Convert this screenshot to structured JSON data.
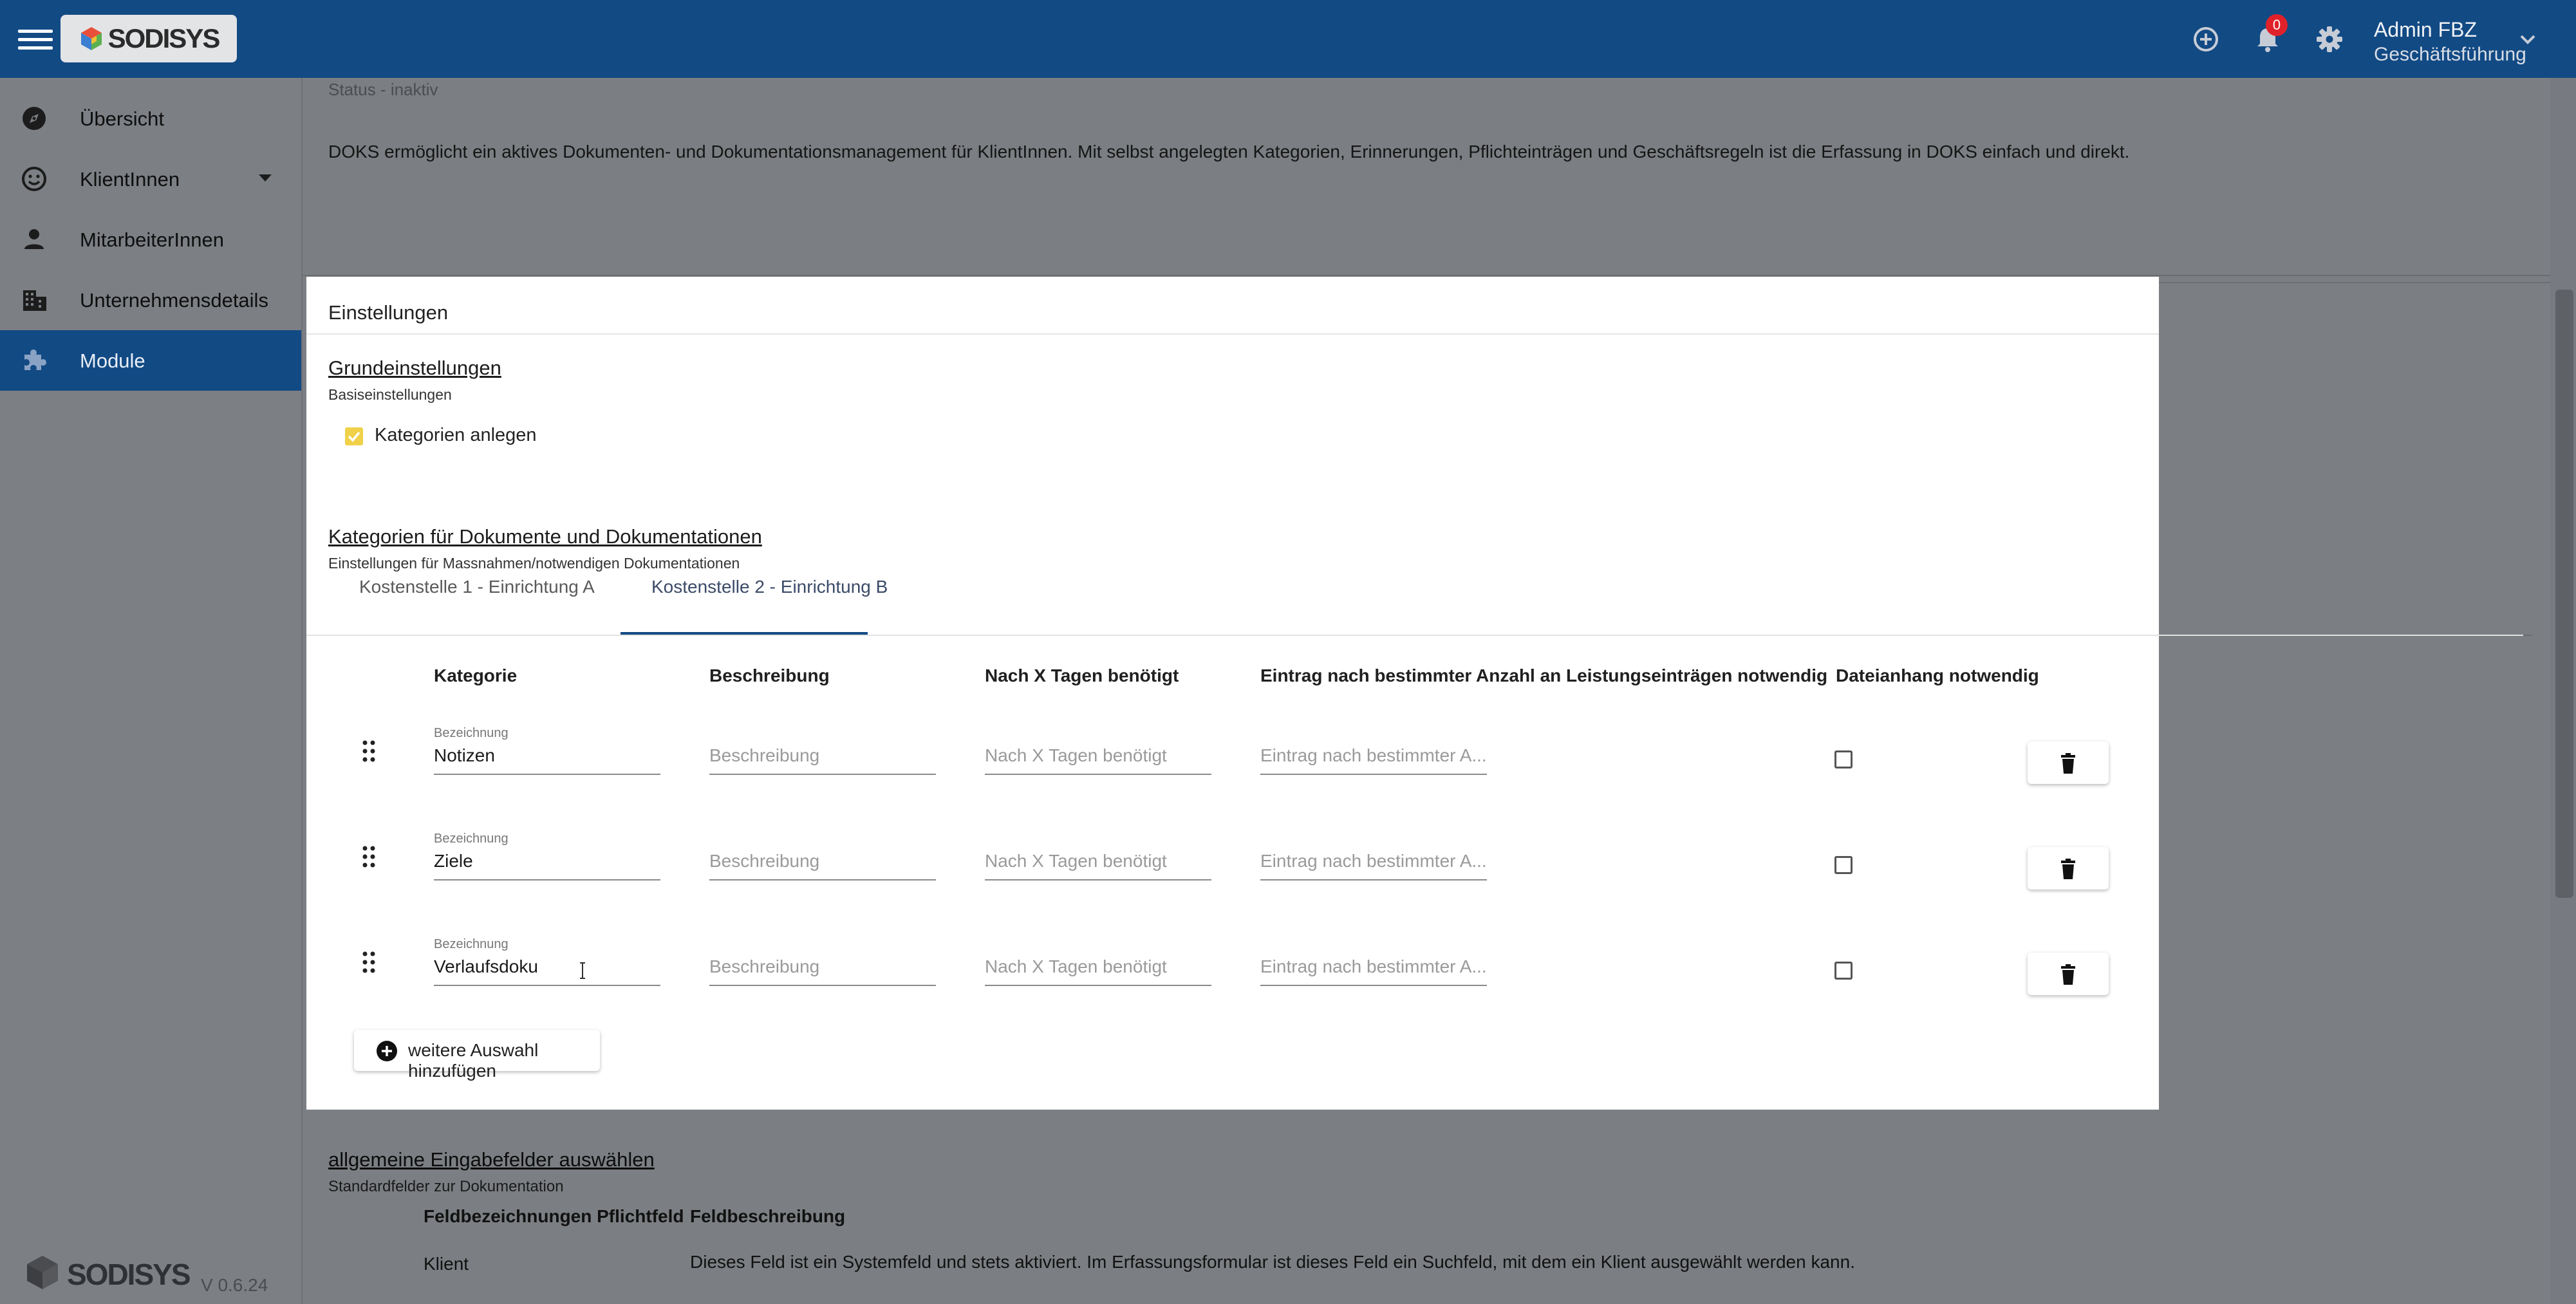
{
  "app": {
    "logo_text": "SODISYS",
    "notifications_count": "0",
    "user_name": "Admin FBZ",
    "user_role": "Geschäftsführung",
    "version": "V 0.6.24",
    "brand_color": "#124a84"
  },
  "sidebar": {
    "items": [
      {
        "label": "Übersicht",
        "icon": "compass-icon"
      },
      {
        "label": "KlientInnen",
        "icon": "smiley-icon"
      },
      {
        "label": "MitarbeiterInnen",
        "icon": "person-icon"
      },
      {
        "label": "Unternehmensdetails",
        "icon": "building-icon"
      },
      {
        "label": "Module",
        "icon": "puzzle-icon",
        "active": true
      }
    ]
  },
  "background": {
    "status": "Status - inaktiv",
    "description": "DOKS ermöglicht ein aktives Dokumenten- und Dokumentationsmanagement für KlientInnen. Mit selbst angelegten Kategorien, Erinnerungen, Pflichteinträgen und Geschäftsregeln ist die Erfassung in DOKS einfach und direkt.",
    "general_fields": {
      "title": "allgemeine Eingabefelder auswählen",
      "subtitle": "Standardfelder zur Dokumentation",
      "headers": [
        "Feldbezeichnungen Pflichtfeld",
        "Feldbeschreibung"
      ],
      "rows": [
        {
          "name": "Klient",
          "desc": "Dieses Feld ist ein Systemfeld und stets aktiviert. Im Erfassungsformular ist dieses Feld ein Suchfeld, mit dem ein Klient ausgewählt werden kann."
        }
      ]
    }
  },
  "dialog": {
    "title": "Einstellungen",
    "basic": {
      "title": "Grundeinstellungen",
      "subtitle": "Basiseinstellungen",
      "checkbox_label": "Kategorien anlegen",
      "checkbox_checked": true
    },
    "categories": {
      "title": "Kategorien für Dokumente und Dokumentationen",
      "subtitle": "Einstellungen für Massnahmen/notwendigen Dokumentationen",
      "tabs": [
        {
          "label": "Kostenstelle 1 - Einrichtung A"
        },
        {
          "label": "Kostenstelle 2 - Einrichtung B",
          "selected": true
        }
      ],
      "columns": [
        "Kategorie",
        "Beschreibung",
        "Nach X Tagen benötigt",
        "Eintrag nach bestimmter Anzahl an Leistungseinträgen notwendig",
        "Dateianhang notwendig"
      ],
      "field_label": "Bezeichnung",
      "placeholders": {
        "description": "Beschreibung",
        "days": "Nach X Tagen benötigt",
        "entries": "Eintrag nach bestimmter A..."
      },
      "rows": [
        {
          "name": "Notizen",
          "attachment_required": false
        },
        {
          "name": "Ziele",
          "attachment_required": false
        },
        {
          "name": "Verlaufsdoku",
          "attachment_required": false
        }
      ],
      "add_button": "weitere Auswahl hinzufügen"
    }
  }
}
